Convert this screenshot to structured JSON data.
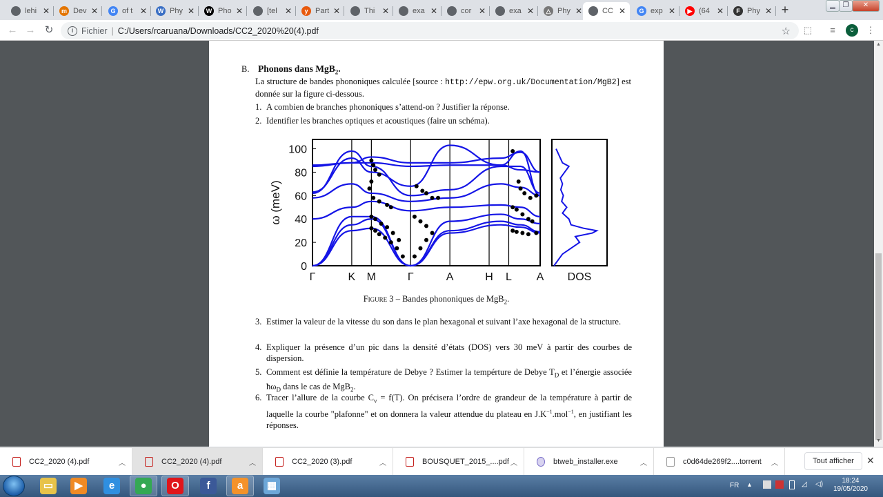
{
  "tabs": [
    {
      "title": "lehi",
      "fav": "#5f6368",
      "g": ""
    },
    {
      "title": "Dev",
      "fav": "#e37400",
      "g": "m"
    },
    {
      "title": "of t",
      "fav": "#4285f4",
      "g": "G"
    },
    {
      "title": "Phy",
      "fav": "#3a6fc4",
      "g": "W"
    },
    {
      "title": "Pho",
      "fav": "#000000",
      "g": "W"
    },
    {
      "title": "[tel",
      "fav": "#5f6368",
      "g": ""
    },
    {
      "title": "Part",
      "fav": "#e8590c",
      "g": "y"
    },
    {
      "title": "Thi",
      "fav": "#5f6368",
      "g": ""
    },
    {
      "title": "exa",
      "fav": "#5f6368",
      "g": ""
    },
    {
      "title": "cor",
      "fav": "#5f6368",
      "g": ""
    },
    {
      "title": "exa",
      "fav": "#5f6368",
      "g": ""
    },
    {
      "title": "Phy",
      "fav": "#777777",
      "g": "△"
    },
    {
      "title": "CC",
      "fav": "#5f6368",
      "g": ""
    },
    {
      "title": "exp",
      "fav": "#4285f4",
      "g": "G"
    },
    {
      "title": "(64",
      "fav": "#ff0000",
      "g": "▶"
    },
    {
      "title": "Phy",
      "fav": "#333333",
      "g": "F"
    }
  ],
  "omnibox": {
    "scheme": "Fichier",
    "url": "C:/Users/rcaruana/Downloads/CC2_2020%20(4).pdf"
  },
  "avatar": "c",
  "doc": {
    "sec_letter": "B.",
    "sec_title": "Phonons dans MgB",
    "sec_sub": "2",
    "intro1": "La structure de bandes phononiques calculée [source : ",
    "intro_url": "http://epw.org.uk/Documentation/MgB2",
    "intro2": "] est donnée sur la figure ci-dessous.",
    "q1": "A combien de branches phononiques s’attend-on ? Justifier la réponse.",
    "q2": "Identifier les branches optiques et acoustiques (faire un schéma).",
    "caption_fig": "Figure 3",
    "caption_txt": " – Bandes phononiques de MgB",
    "caption_sub": "2",
    "q3": "Estimer la valeur de la vitesse du son dans le plan hexagonal et suivant l’axe hexagonal de la structure.",
    "q4": "Expliquer la présence d’un pic dans la densité d’états (DOS) vers 30 meV à partir des courbes de dispersion.",
    "q5a": "Comment est définie la température de Debye ? Estimer la tempérture de Debye T",
    "q5b": "D",
    "q5c": " et l’énergie associée ħω",
    "q5d": "D",
    "q5e": " dans le cas de MgB",
    "q5f": "2",
    "q5g": ".",
    "q6a": "Tracer l’allure de la courbe C",
    "q6b": "v",
    "q6c": " = f(T). On précisera l’ordre de grandeur de la température à partir de laquelle la courbe \"plafonne\" et on donnera la valeur attendue du plateau en J.K",
    "q6d": "−1",
    "q6e": ".mol",
    "q6f": "−1",
    "q6g": ", en justifiant les réponses.",
    "n1": "1.",
    "n2": "2.",
    "n3": "3.",
    "n4": "4.",
    "n5": "5.",
    "n6": "6."
  },
  "chart_data": {
    "type": "line",
    "ylabel": "ω (meV)",
    "ylim": [
      0,
      100
    ],
    "yticks": [
      "0",
      "20",
      "40",
      "60",
      "80",
      "100"
    ],
    "xticks": [
      "Γ",
      "K",
      "M",
      "Γ",
      "A",
      "H",
      "L",
      "A"
    ],
    "dos_label": "DOS",
    "series_note": "9 calculated branches (lines) plus measured points (dots)",
    "branches": [
      [
        [
          0,
          0
        ],
        [
          1,
          30
        ],
        [
          1.5,
          32
        ],
        [
          2.5,
          0
        ],
        [
          3.5,
          28
        ],
        [
          4.8,
          35
        ],
        [
          5.3,
          33
        ],
        [
          5.8,
          28
        ]
      ],
      [
        [
          0,
          0
        ],
        [
          1,
          35
        ],
        [
          1.5,
          40
        ],
        [
          2.5,
          0
        ],
        [
          3.5,
          30
        ],
        [
          4.8,
          38
        ],
        [
          5.3,
          35
        ],
        [
          5.8,
          29
        ]
      ],
      [
        [
          0,
          0
        ],
        [
          1,
          42
        ],
        [
          1.5,
          42
        ],
        [
          2.5,
          0
        ],
        [
          3.5,
          38
        ],
        [
          4.8,
          44
        ],
        [
          5.3,
          40
        ],
        [
          5.8,
          36
        ]
      ],
      [
        [
          0,
          40
        ],
        [
          1,
          50
        ],
        [
          1.5,
          55
        ],
        [
          2.5,
          47
        ],
        [
          3.5,
          50
        ],
        [
          4.8,
          52
        ],
        [
          5.3,
          50
        ],
        [
          5.8,
          42
        ]
      ],
      [
        [
          0,
          58
        ],
        [
          1,
          70
        ],
        [
          1.5,
          62
        ],
        [
          2.5,
          55
        ],
        [
          3.5,
          58
        ],
        [
          4.8,
          70
        ],
        [
          5.3,
          67
        ],
        [
          5.8,
          60
        ]
      ],
      [
        [
          0,
          62
        ],
        [
          1,
          98
        ],
        [
          1.5,
          85
        ],
        [
          2.5,
          60
        ],
        [
          3.5,
          65
        ],
        [
          4.8,
          85
        ],
        [
          5.3,
          85
        ],
        [
          5.8,
          62
        ]
      ],
      [
        [
          0,
          63
        ],
        [
          1,
          92
        ],
        [
          1.5,
          80
        ],
        [
          2.5,
          68
        ],
        [
          3.5,
          103
        ],
        [
          4.8,
          86
        ],
        [
          5.3,
          98
        ],
        [
          5.8,
          60
        ]
      ],
      [
        [
          0,
          85
        ],
        [
          1,
          88
        ],
        [
          1.5,
          88
        ],
        [
          2.5,
          85
        ],
        [
          3.5,
          86
        ],
        [
          4.8,
          86
        ],
        [
          5.3,
          82
        ],
        [
          5.8,
          80
        ]
      ],
      [
        [
          0,
          86
        ],
        [
          1,
          88
        ],
        [
          1.5,
          93
        ],
        [
          2.5,
          88
        ],
        [
          3.5,
          88
        ],
        [
          4.8,
          92
        ],
        [
          5.3,
          97
        ],
        [
          5.8,
          80
        ]
      ]
    ],
    "points": [
      [
        1.5,
        90
      ],
      [
        1.55,
        86
      ],
      [
        1.6,
        82
      ],
      [
        1.7,
        78
      ],
      [
        1.5,
        72
      ],
      [
        1.45,
        66
      ],
      [
        1.55,
        58
      ],
      [
        1.7,
        55
      ],
      [
        1.9,
        52
      ],
      [
        2.0,
        50
      ],
      [
        1.5,
        42
      ],
      [
        1.6,
        40
      ],
      [
        1.75,
        36
      ],
      [
        1.9,
        33
      ],
      [
        2.05,
        28
      ],
      [
        2.2,
        22
      ],
      [
        1.5,
        32
      ],
      [
        1.6,
        30
      ],
      [
        1.7,
        27
      ],
      [
        1.85,
        24
      ],
      [
        2.0,
        20
      ],
      [
        2.15,
        15
      ],
      [
        2.3,
        8
      ],
      [
        2.6,
        8
      ],
      [
        2.75,
        15
      ],
      [
        2.9,
        22
      ],
      [
        3.05,
        28
      ],
      [
        2.65,
        68
      ],
      [
        2.8,
        64
      ],
      [
        2.9,
        62
      ],
      [
        3.05,
        58
      ],
      [
        3.2,
        58
      ],
      [
        2.6,
        42
      ],
      [
        2.75,
        38
      ],
      [
        2.9,
        34
      ],
      [
        5.1,
        98
      ],
      [
        5.25,
        72
      ],
      [
        5.3,
        66
      ],
      [
        5.4,
        62
      ],
      [
        5.55,
        58
      ],
      [
        5.7,
        60
      ],
      [
        5.1,
        50
      ],
      [
        5.2,
        48
      ],
      [
        5.35,
        44
      ],
      [
        5.5,
        40
      ],
      [
        5.6,
        38
      ],
      [
        5.1,
        30
      ],
      [
        5.2,
        29
      ],
      [
        5.35,
        28
      ],
      [
        5.5,
        27
      ],
      [
        5.7,
        28
      ]
    ],
    "dos": [
      [
        0,
        0
      ],
      [
        10,
        0.2
      ],
      [
        20,
        0.6
      ],
      [
        25,
        0.5
      ],
      [
        28,
        0.9
      ],
      [
        30,
        1.0
      ],
      [
        32,
        0.7
      ],
      [
        35,
        0.4
      ],
      [
        40,
        0.35
      ],
      [
        45,
        0.2
      ],
      [
        50,
        0.3
      ],
      [
        55,
        0.18
      ],
      [
        60,
        0.22
      ],
      [
        65,
        0.16
      ],
      [
        70,
        0.2
      ],
      [
        75,
        0.15
      ],
      [
        80,
        0.25
      ],
      [
        85,
        0.35
      ],
      [
        88,
        0.2
      ],
      [
        92,
        0.15
      ],
      [
        100,
        0.05
      ]
    ]
  },
  "downloads": [
    {
      "name": "CC2_2020 (4).pdf",
      "kind": "pdf"
    },
    {
      "name": "CC2_2020 (4).pdf",
      "kind": "pdf"
    },
    {
      "name": "CC2_2020 (3).pdf",
      "kind": "pdf"
    },
    {
      "name": "BOUSQUET_2015_....pdf",
      "kind": "pdf"
    },
    {
      "name": "btweb_installer.exe",
      "kind": "exe"
    },
    {
      "name": "c0d64de269f2....torrent",
      "kind": "gen"
    }
  ],
  "show_all": "Tout afficher",
  "tray": {
    "lang": "FR",
    "time": "18:24",
    "date": "19/05/2020"
  },
  "taskbar": [
    {
      "name": "explorer",
      "color": "#e7c34a",
      "glyph": "▭"
    },
    {
      "name": "media-player",
      "color": "#f08a24",
      "glyph": "▶"
    },
    {
      "name": "internet-explorer",
      "color": "#2f8fe0",
      "glyph": "e"
    },
    {
      "name": "chrome",
      "color": "#34a853",
      "glyph": "●"
    },
    {
      "name": "opera",
      "color": "#e0151b",
      "glyph": "O"
    },
    {
      "name": "facebook",
      "color": "#3b5998",
      "glyph": "f"
    },
    {
      "name": "avast",
      "color": "#f4922a",
      "glyph": "a"
    },
    {
      "name": "control-panel",
      "color": "#6da7d8",
      "glyph": "▦"
    }
  ]
}
